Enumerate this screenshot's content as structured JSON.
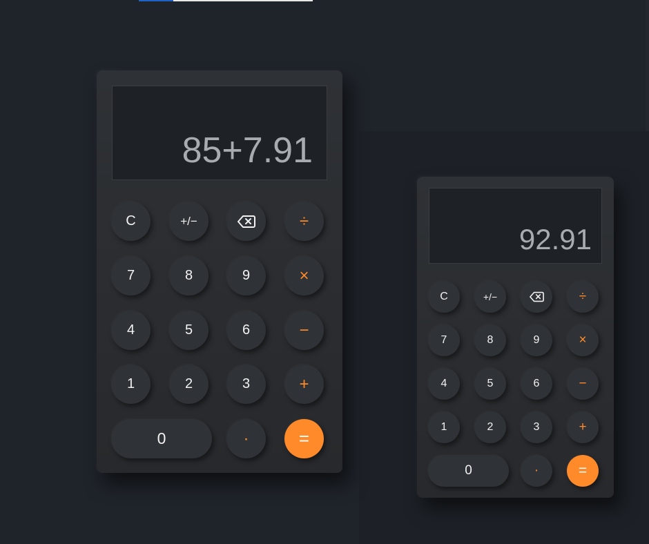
{
  "calculators": [
    {
      "display": "85+7.91",
      "keys": {
        "clear": "C",
        "sign": "+/−",
        "divide": "÷",
        "seven": "7",
        "eight": "8",
        "nine": "9",
        "multiply": "×",
        "four": "4",
        "five": "5",
        "six": "6",
        "minus": "−",
        "one": "1",
        "two": "2",
        "three": "3",
        "plus": "+",
        "zero": "0",
        "decimal": "·",
        "equals": "="
      }
    },
    {
      "display": "92.91",
      "keys": {
        "clear": "C",
        "sign": "+/−",
        "divide": "÷",
        "seven": "7",
        "eight": "8",
        "nine": "9",
        "multiply": "×",
        "four": "4",
        "five": "5",
        "six": "6",
        "minus": "−",
        "one": "1",
        "two": "2",
        "three": "3",
        "plus": "+",
        "zero": "0",
        "decimal": "·",
        "equals": "="
      }
    }
  ],
  "icons": {
    "backspace": "backspace-icon"
  },
  "colors": {
    "accent": "#ff8a2a",
    "background": "#1f232a",
    "body": "#2e3135",
    "display": "#1e2227",
    "key": "#2f3236"
  }
}
